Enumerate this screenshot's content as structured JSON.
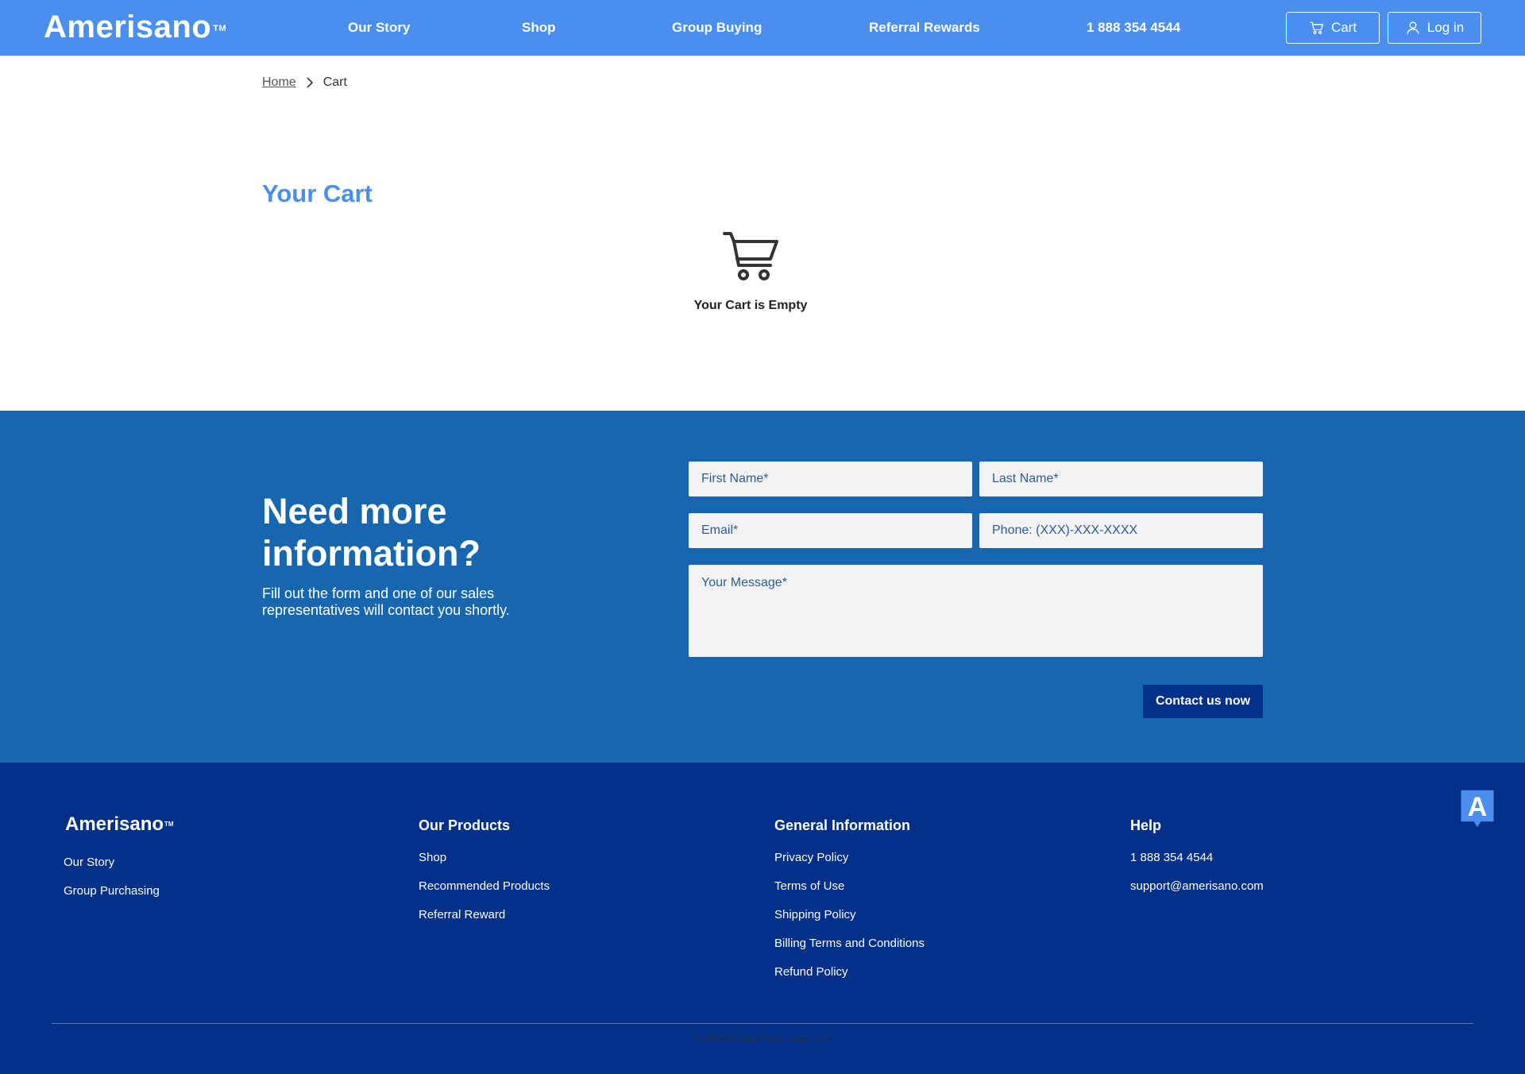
{
  "header": {
    "logo": "Amerisano",
    "logo_tm": "TM",
    "nav": [
      {
        "label": "Our Story"
      },
      {
        "label": "Shop"
      },
      {
        "label": "Group Buying"
      },
      {
        "label": "Referral Rewards"
      },
      {
        "label": "1 888 354 4544"
      }
    ],
    "cart_label": "Cart",
    "login_label": "Log in",
    "accent_color": "#4a8ef0"
  },
  "breadcrumb": {
    "home": "Home",
    "current": "Cart"
  },
  "cart": {
    "title": "Your Cart",
    "empty_text": "Your Cart is Empty",
    "icon": "shopping-cart-icon"
  },
  "contact": {
    "heading": "Need more information?",
    "description": "Fill out the form and one of our sales representatives will contact you shortly.",
    "first_name_placeholder": "First Name*",
    "last_name_placeholder": "Last Name*",
    "email_placeholder": "Email*",
    "phone_placeholder": "Phone: (XXX)-XXX-XXXX",
    "message_placeholder": "Your Message*",
    "submit_label": "Contact us now",
    "bg_color": "#1666b0",
    "button_color": "#003087"
  },
  "footer": {
    "logo": "Amerisano",
    "logo_tm": "TM",
    "brand_links": [
      "Our Story",
      "Group Purchasing"
    ],
    "products": {
      "heading": "Our Products",
      "links": [
        "Shop",
        "Recommended Products",
        "Referral Reward"
      ]
    },
    "general": {
      "heading": "General Information",
      "links": [
        "Privacy Policy",
        "Terms of Use",
        "Shipping Policy",
        "Billing Terms and Conditions",
        "Refund Policy"
      ]
    },
    "help": {
      "heading": "Help",
      "links": [
        "1 888 354 4544",
        "support@amerisano.com"
      ]
    },
    "copyright": "© 2022 Rocket Distributors, LLC",
    "bg_color": "#003087"
  },
  "badge": {
    "letter": "A",
    "icon": "accessibility-a-icon"
  }
}
